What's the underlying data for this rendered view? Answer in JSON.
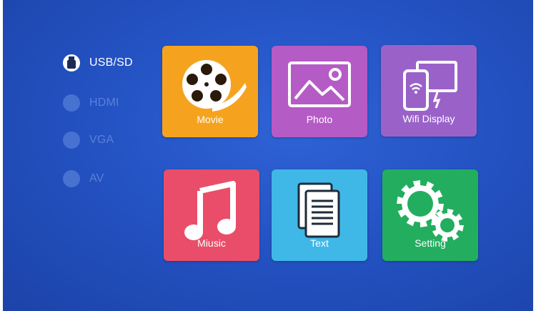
{
  "sources": [
    {
      "label": "USB/SD",
      "icon": "usb-icon",
      "active": true
    },
    {
      "label": "HDMI",
      "icon": "hdmi-icon",
      "active": false
    },
    {
      "label": "VGA",
      "icon": "vga-icon",
      "active": false
    },
    {
      "label": "AV",
      "icon": "av-icon",
      "active": false
    }
  ],
  "tiles": [
    {
      "label": "Movie",
      "icon": "film-reel-icon",
      "color": "#f5a31f"
    },
    {
      "label": "Photo",
      "icon": "picture-icon",
      "color": "#b55bc6"
    },
    {
      "label": "Wifi Display",
      "icon": "wifi-display-icon",
      "color": "#9a62c9"
    },
    {
      "label": "Miusic",
      "icon": "music-note-icon",
      "color": "#ea4d69"
    },
    {
      "label": "Text",
      "icon": "document-icon",
      "color": "#3fb8e8"
    },
    {
      "label": "Setting",
      "icon": "gears-icon",
      "color": "#23ae5f"
    }
  ],
  "colors": {
    "background": "#2453c4",
    "active_text": "#ffffff",
    "inactive_text": "#5a80d8"
  }
}
